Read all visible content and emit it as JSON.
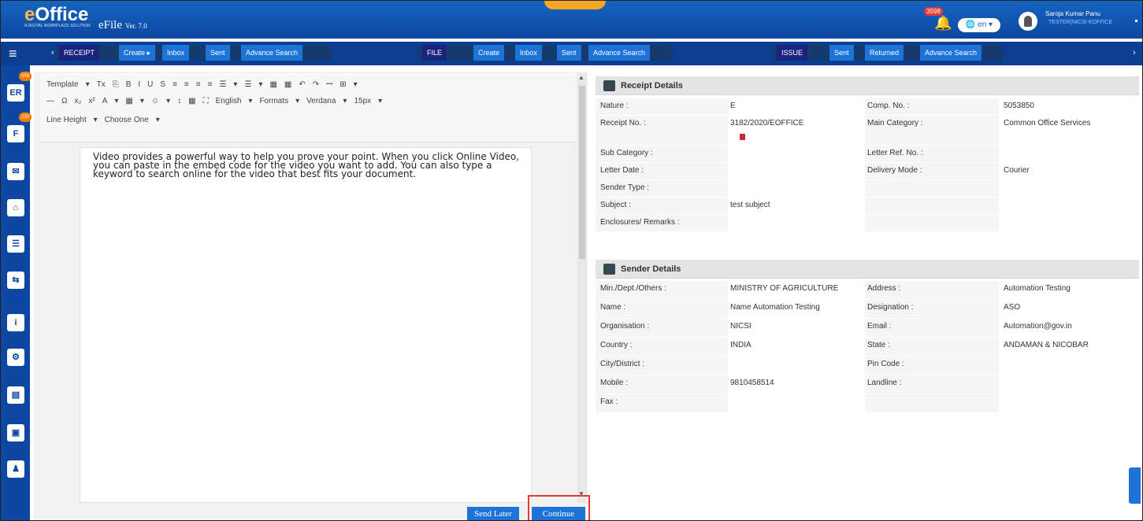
{
  "header": {
    "logo": "eOffice",
    "logo_sub": "A DIGITAL WORKPLACE SOLUTION",
    "product": "eFile",
    "version": "Ver. 7.0",
    "notif_count": "3598",
    "lang": "en",
    "user_name": "Saroja Kumar Panu",
    "user_dept": "TESTER(NICSI-EOFFICE"
  },
  "nav": {
    "receipt": "RECEIPT",
    "receipt_items": [
      "Create",
      "Inbox",
      "Sent",
      "Advance Search"
    ],
    "file": "FILE",
    "file_items": [
      "Create",
      "Inbox",
      "Sent",
      "Advance Search"
    ],
    "issue": "ISSUE",
    "issue_items": [
      "Sent",
      "Returned",
      "Advance Search"
    ]
  },
  "sidebar": {
    "badges": [
      "558",
      "230"
    ]
  },
  "editor": {
    "toolbar_row1": [
      "Template",
      "▾",
      "Tx",
      "⎘",
      "B",
      "I",
      "U",
      "S",
      "≡",
      "≡",
      "≡",
      "≡",
      "☰",
      "▾",
      "☰",
      "▾",
      "▦",
      "▦",
      "↶",
      "↷",
      "ꟷ",
      "⊞",
      "▾"
    ],
    "toolbar_row2": [
      "—",
      "Ω",
      "x₂",
      "x²",
      "A",
      "▾",
      "▦",
      "▾",
      "☺",
      "▾",
      "↕",
      "▦",
      "⛶",
      "English",
      "▾",
      "Formats",
      "▾",
      "Verdana",
      "▾",
      "15px",
      "▾"
    ],
    "toolbar_row3": [
      "Line Height",
      "▾",
      "Choose One",
      "▾"
    ],
    "content": "Video provides a powerful way to help you prove your point. When you click Online Video, you can paste in the embed code for the video you want to add. You can also type a keyword to search online for the video that best fits your document.",
    "send_later": "Send Later",
    "continue": "Continue"
  },
  "receipt_details": {
    "title": "Receipt Details",
    "rows": [
      {
        "l1": "Nature :",
        "v1": "E",
        "l2": "Comp. No. :",
        "v2": "5053850"
      },
      {
        "l1": "Receipt No. :",
        "v1": "3182/2020/EOFFICE",
        "l2": "Main Category :",
        "v2": "Common Office Services"
      },
      {
        "l1": "Sub Category :",
        "v1": "",
        "l2": "Letter Ref. No. :",
        "v2": ""
      },
      {
        "l1": "Letter Date :",
        "v1": "",
        "l2": "Delivery Mode :",
        "v2": "Courier"
      },
      {
        "l1": "Sender Type :",
        "v1": "",
        "l2": "",
        "v2": ""
      },
      {
        "l1": "Subject :",
        "v1": "test subject",
        "l2": "",
        "v2": ""
      },
      {
        "l1": "Enclosures/ Remarks :",
        "v1": "",
        "l2": "",
        "v2": ""
      }
    ]
  },
  "sender_details": {
    "title": "Sender Details",
    "rows": [
      {
        "l1": "Min./Dept./Others :",
        "v1": "MINISTRY OF AGRICULTURE",
        "l2": "Address :",
        "v2": "Automation Testing"
      },
      {
        "l1": "Name :",
        "v1": "Name Automation Testing",
        "l2": "Designation :",
        "v2": "ASO"
      },
      {
        "l1": "Organisation :",
        "v1": "NICSI",
        "l2": "Email :",
        "v2": "Automation@gov.in"
      },
      {
        "l1": "Country :",
        "v1": "INDIA",
        "l2": "State :",
        "v2": "ANDAMAN & NICOBAR"
      },
      {
        "l1": "City/District :",
        "v1": "",
        "l2": "Pin Code :",
        "v2": ""
      },
      {
        "l1": "Mobile :",
        "v1": "9810458514",
        "l2": "Landline :",
        "v2": ""
      },
      {
        "l1": "Fax :",
        "v1": "",
        "l2": "",
        "v2": ""
      }
    ]
  }
}
